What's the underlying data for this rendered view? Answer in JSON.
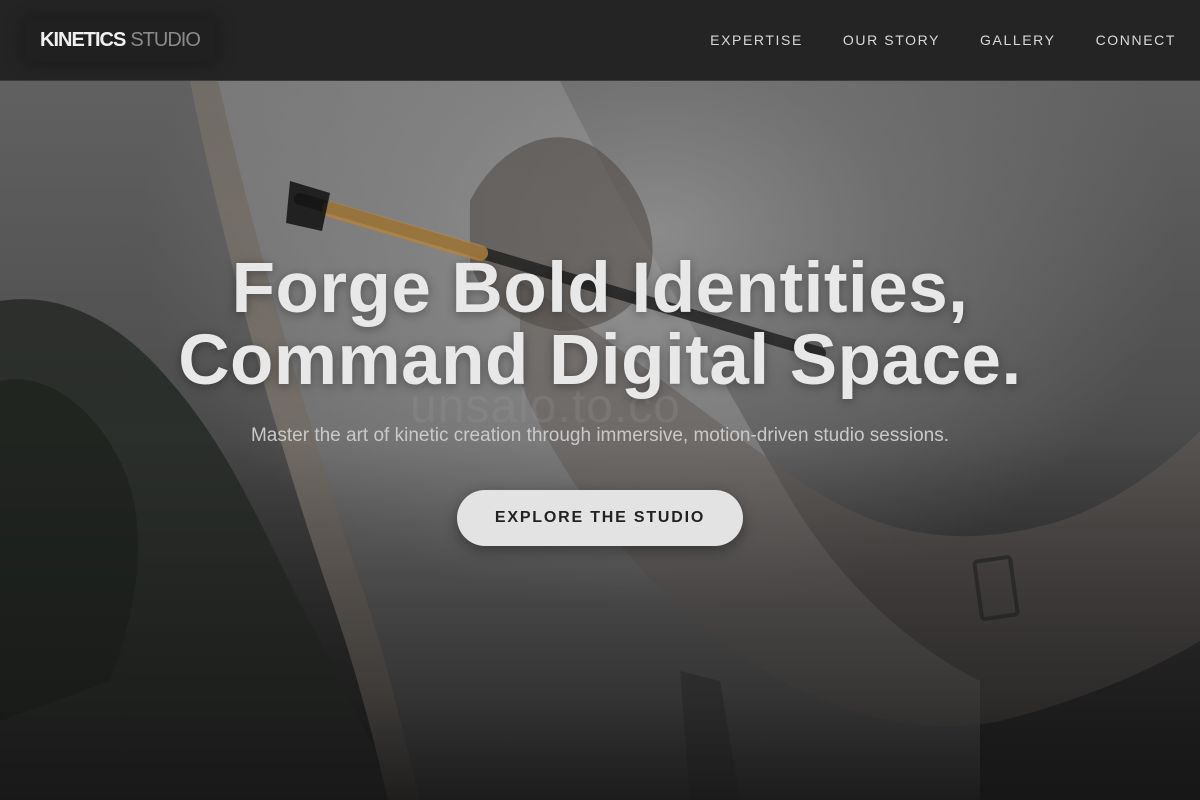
{
  "header": {
    "logo": {
      "bold": "KINETICS",
      "light": "STUDIO"
    },
    "nav": [
      {
        "label": "EXPERTISE"
      },
      {
        "label": "OUR STORY"
      },
      {
        "label": "GALLERY"
      },
      {
        "label": "CONNECT"
      }
    ]
  },
  "hero": {
    "title_line1": "Forge Bold Identities,",
    "title_line2": "Command Digital Space.",
    "subtitle": "Master the art of kinetic creation through immersive, motion-driven studio sessions.",
    "cta_label": "EXPLORE THE STUDIO",
    "watermark": "unsalo.to.co"
  }
}
